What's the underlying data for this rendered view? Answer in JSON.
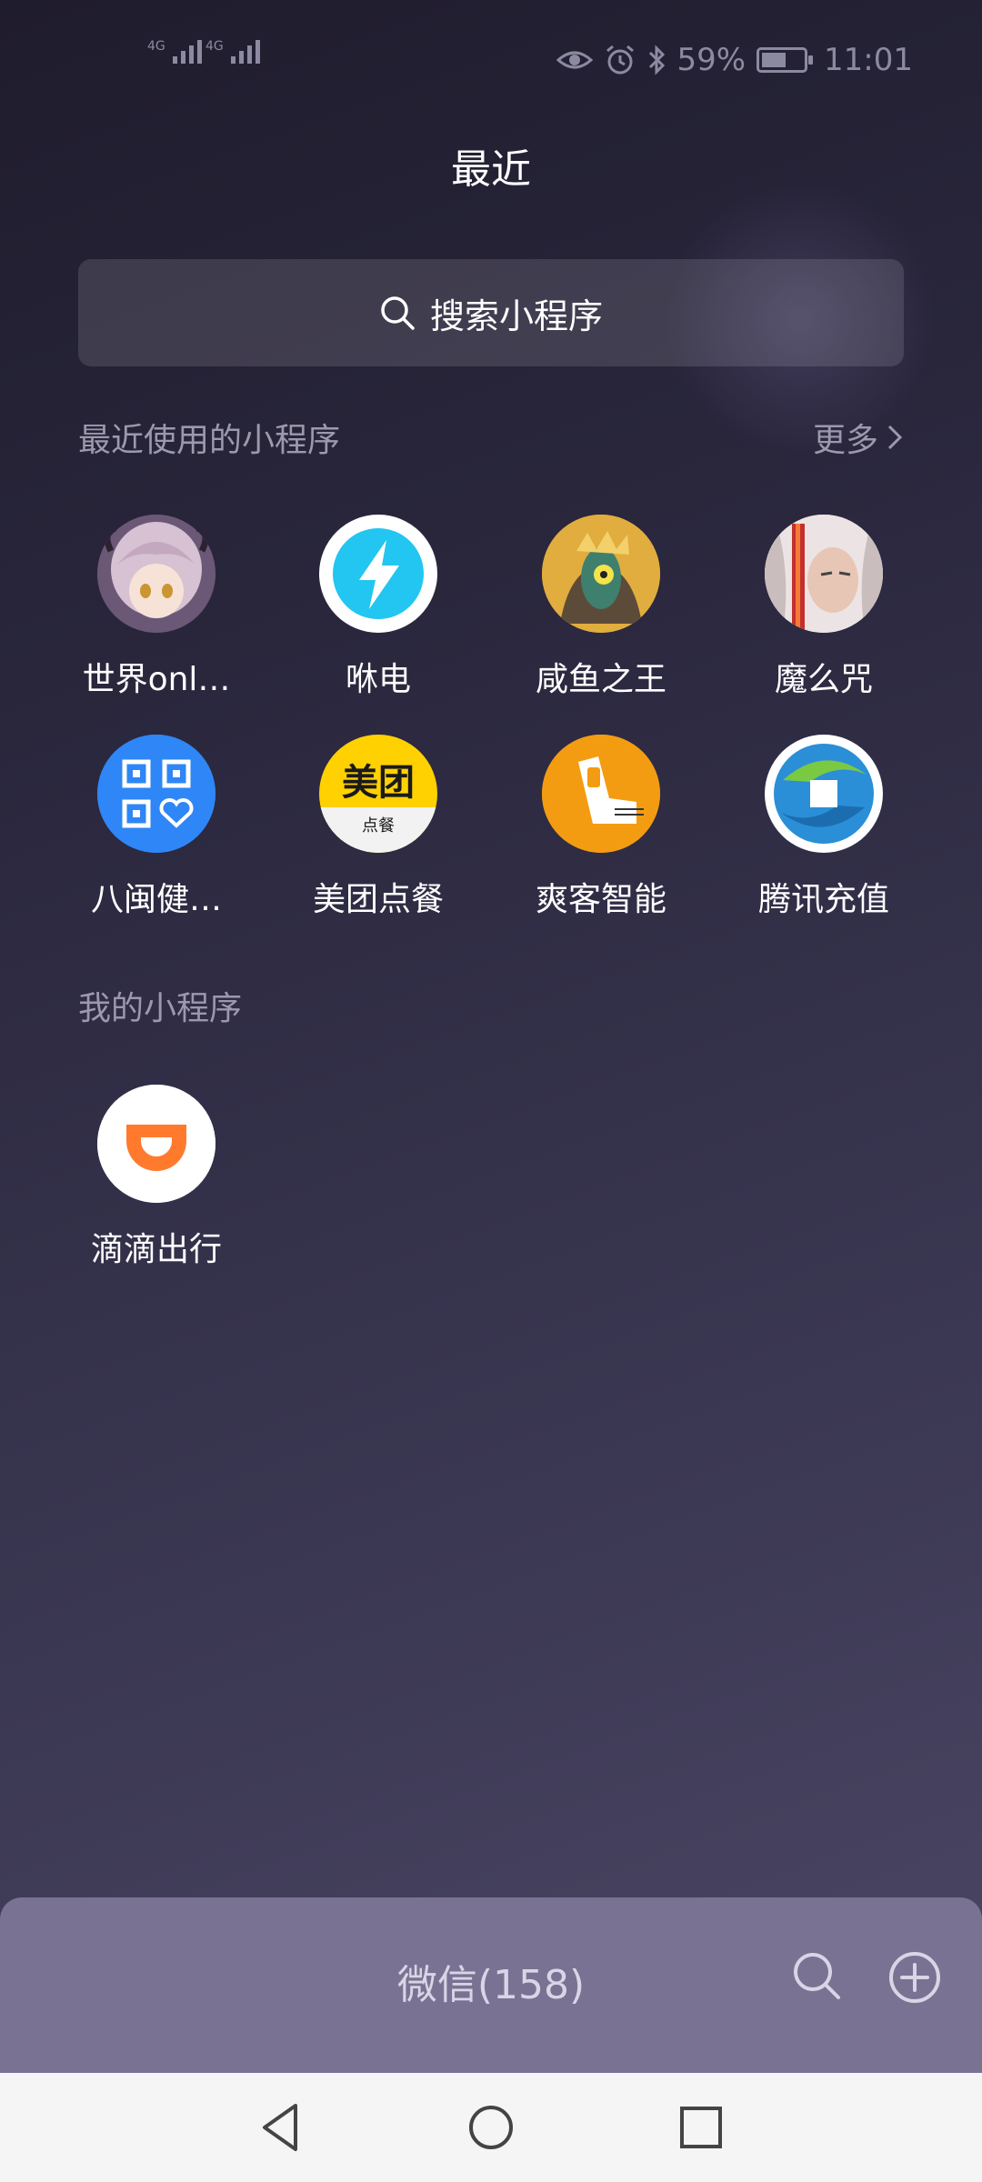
{
  "status_bar": {
    "network_1": "4G",
    "network_2": "4G",
    "battery_percent": "59%",
    "time": "11:01"
  },
  "header": {
    "title": "最近"
  },
  "search": {
    "placeholder": "搜索小程序"
  },
  "recent": {
    "title": "最近使用的小程序",
    "more_label": "更多",
    "apps": [
      {
        "label": "世界onl…",
        "icon": "anime-avatar-icon"
      },
      {
        "label": "咻电",
        "icon": "lightning-icon"
      },
      {
        "label": "咸鱼之王",
        "icon": "fish-king-icon"
      },
      {
        "label": "魔么咒",
        "icon": "warrior-avatar-icon"
      },
      {
        "label": "八闽健…",
        "icon": "health-qr-icon"
      },
      {
        "label": "美团点餐",
        "icon": "meituan-icon",
        "icon_text": "美团",
        "icon_subtext": "点餐"
      },
      {
        "label": "爽客智能",
        "icon": "shuangke-icon"
      },
      {
        "label": "腾讯充值",
        "icon": "tencent-recharge-icon"
      }
    ]
  },
  "mine": {
    "title": "我的小程序",
    "apps": [
      {
        "label": "滴滴出行",
        "icon": "didi-icon"
      }
    ]
  },
  "bottom_bar": {
    "title": "微信(158)"
  },
  "colors": {
    "accent_blue": "#2f86f6",
    "meituan_yellow": "#ffd100",
    "didi_orange": "#ff7a2d",
    "shuangke_orange": "#f39c12"
  }
}
